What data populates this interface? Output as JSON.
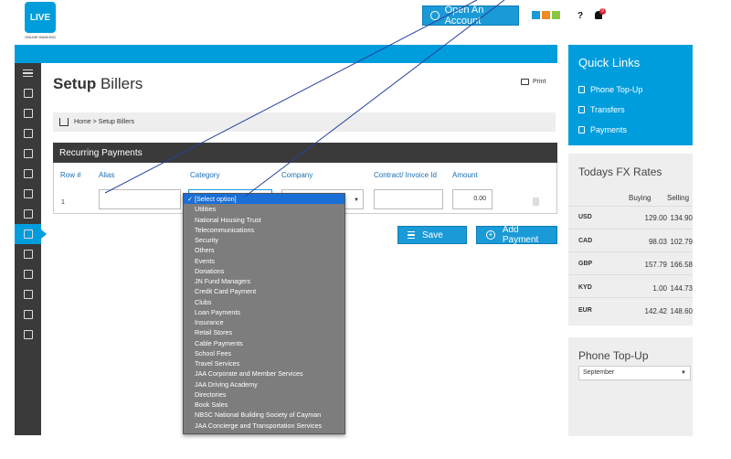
{
  "brand": {
    "logo_text": "LIVE",
    "logo_sub": "ONLINE BANKING"
  },
  "header": {
    "open_account_label": "Open An Account",
    "help_label": "?",
    "notification_count": "0",
    "color_squares": [
      "#1a9ad6",
      "#f08a24",
      "#8dc63f"
    ]
  },
  "sidebar": {
    "items": [
      "menu-icon",
      "home-icon",
      "desktop-icon",
      "calculator-icon",
      "card-icon",
      "user-icon",
      "download-icon",
      "money-icon",
      "bills-icon",
      "users-icon",
      "coins-icon",
      "document-icon",
      "bank-icon",
      "display-icon"
    ],
    "active_index": 8
  },
  "page": {
    "title_bold": "Setup",
    "title_rest": "Billers",
    "print_label": "Print",
    "breadcrumb": "Home > Setup Billers"
  },
  "recurring": {
    "heading": "Recurring Payments",
    "columns": [
      "Row #",
      "Alias",
      "Category",
      "Company",
      "Contract/ Invoice Id",
      "Amount"
    ],
    "row": {
      "num": "1",
      "alias": "",
      "category": "[Select option]",
      "contract": "",
      "amount": "0.00"
    }
  },
  "buttons": {
    "save_label": "Save",
    "add_payment_label": "Add Payment"
  },
  "dropdown": {
    "selected": "✓ [Select option]",
    "options": [
      "Utilities",
      "National Housing Trust",
      "Telecommunications",
      "Security",
      "Others",
      "Events",
      "Donations",
      "JN Fund Managers",
      "Credit Card Payment",
      "Clubs",
      "Loan Payments",
      "Insurance",
      "Retail Stores",
      "Cable Payments",
      "School Fees",
      "Travel Services",
      "JAA Corporate and Member Services",
      "JAA Driving Academy",
      "Directories",
      "Book Sales",
      "NBSC National Building Society of Cayman",
      "JAA Concierge and Transportation Services"
    ]
  },
  "quick_links": {
    "title": "Quick Links",
    "items": [
      "Phone Top-Up",
      "Transfers",
      "Payments"
    ]
  },
  "fx": {
    "title": "Todays FX Rates",
    "buying_label": "Buying",
    "selling_label": "Selling",
    "rates": [
      {
        "cur": "USD",
        "buy": "129.00",
        "sell": "134.90"
      },
      {
        "cur": "CAD",
        "buy": "98.03",
        "sell": "102.79"
      },
      {
        "cur": "GBP",
        "buy": "157.79",
        "sell": "166.58"
      },
      {
        "cur": "KYD",
        "buy": "1.00",
        "sell": "144.73"
      },
      {
        "cur": "EUR",
        "buy": "142.42",
        "sell": "148.60"
      }
    ]
  },
  "topup": {
    "title": "Phone Top-Up",
    "month": "September"
  }
}
